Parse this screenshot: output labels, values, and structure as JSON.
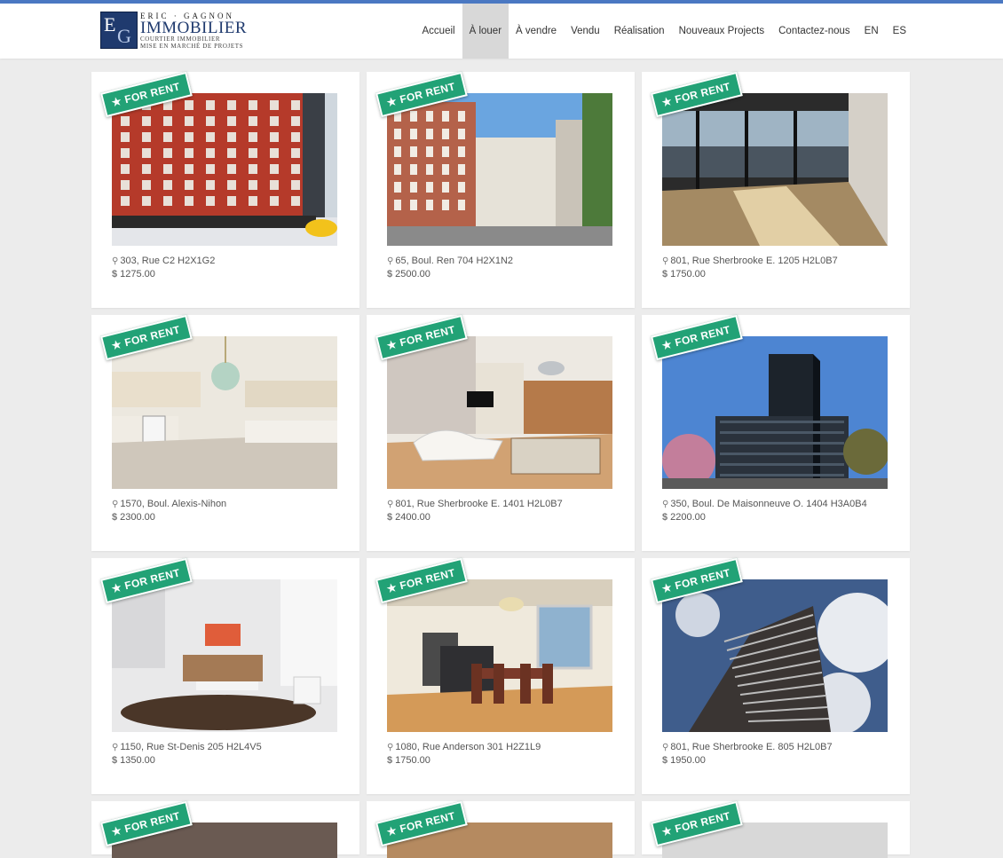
{
  "header": {
    "logo": {
      "mark_letters": [
        "E",
        "G"
      ],
      "name": "ERIC · GAGNON",
      "big": "IMMOBILIER",
      "sub1": "COURTIER IMMOBILIER",
      "sub2": "MISE EN MARCHÉ DE PROJETS"
    },
    "nav": [
      {
        "label": "Accueil",
        "active": false
      },
      {
        "label": "À louer",
        "active": true
      },
      {
        "label": "À vendre",
        "active": false
      },
      {
        "label": "Vendu",
        "active": false
      },
      {
        "label": "Réalisation",
        "active": false
      },
      {
        "label": "Nouveaux Projects",
        "active": false
      },
      {
        "label": "Contactez-nous",
        "active": false
      },
      {
        "label": "EN",
        "active": false
      },
      {
        "label": "ES",
        "active": false
      }
    ]
  },
  "badge_label": "FOR RENT",
  "listings": [
    {
      "address": "303, Rue C2 H2X1G2",
      "price": "1275.00",
      "scene": "red-building"
    },
    {
      "address": "65, Boul. Ren 704 H2X1N2",
      "price": "2500.00",
      "scene": "brick-street"
    },
    {
      "address": "801, Rue Sherbrooke E. 1205 H2L0B7",
      "price": "1750.00",
      "scene": "window-view"
    },
    {
      "address": "1570, Boul. Alexis-Nihon",
      "price": "2300.00",
      "scene": "kitchen"
    },
    {
      "address": "801, Rue Sherbrooke E. 1401 H2L0B7",
      "price": "2400.00",
      "scene": "living-room"
    },
    {
      "address": "350, Boul. De Maisonneuve O. 1404 H3A0B4",
      "price": "2200.00",
      "scene": "tower"
    },
    {
      "address": "1150, Rue St-Denis 205 H2L4V5",
      "price": "1350.00",
      "scene": "lounge"
    },
    {
      "address": "1080, Rue Anderson 301 H2Z1L9",
      "price": "1750.00",
      "scene": "dining"
    },
    {
      "address": "801, Rue Sherbrooke E. 805 H2L0B7",
      "price": "1950.00",
      "scene": "sky-tower"
    }
  ],
  "partial_row_count": 3,
  "colors": {
    "accent_bar": "#4a78c2",
    "badge": "#22a276",
    "active_nav": "#d8d8d8"
  }
}
